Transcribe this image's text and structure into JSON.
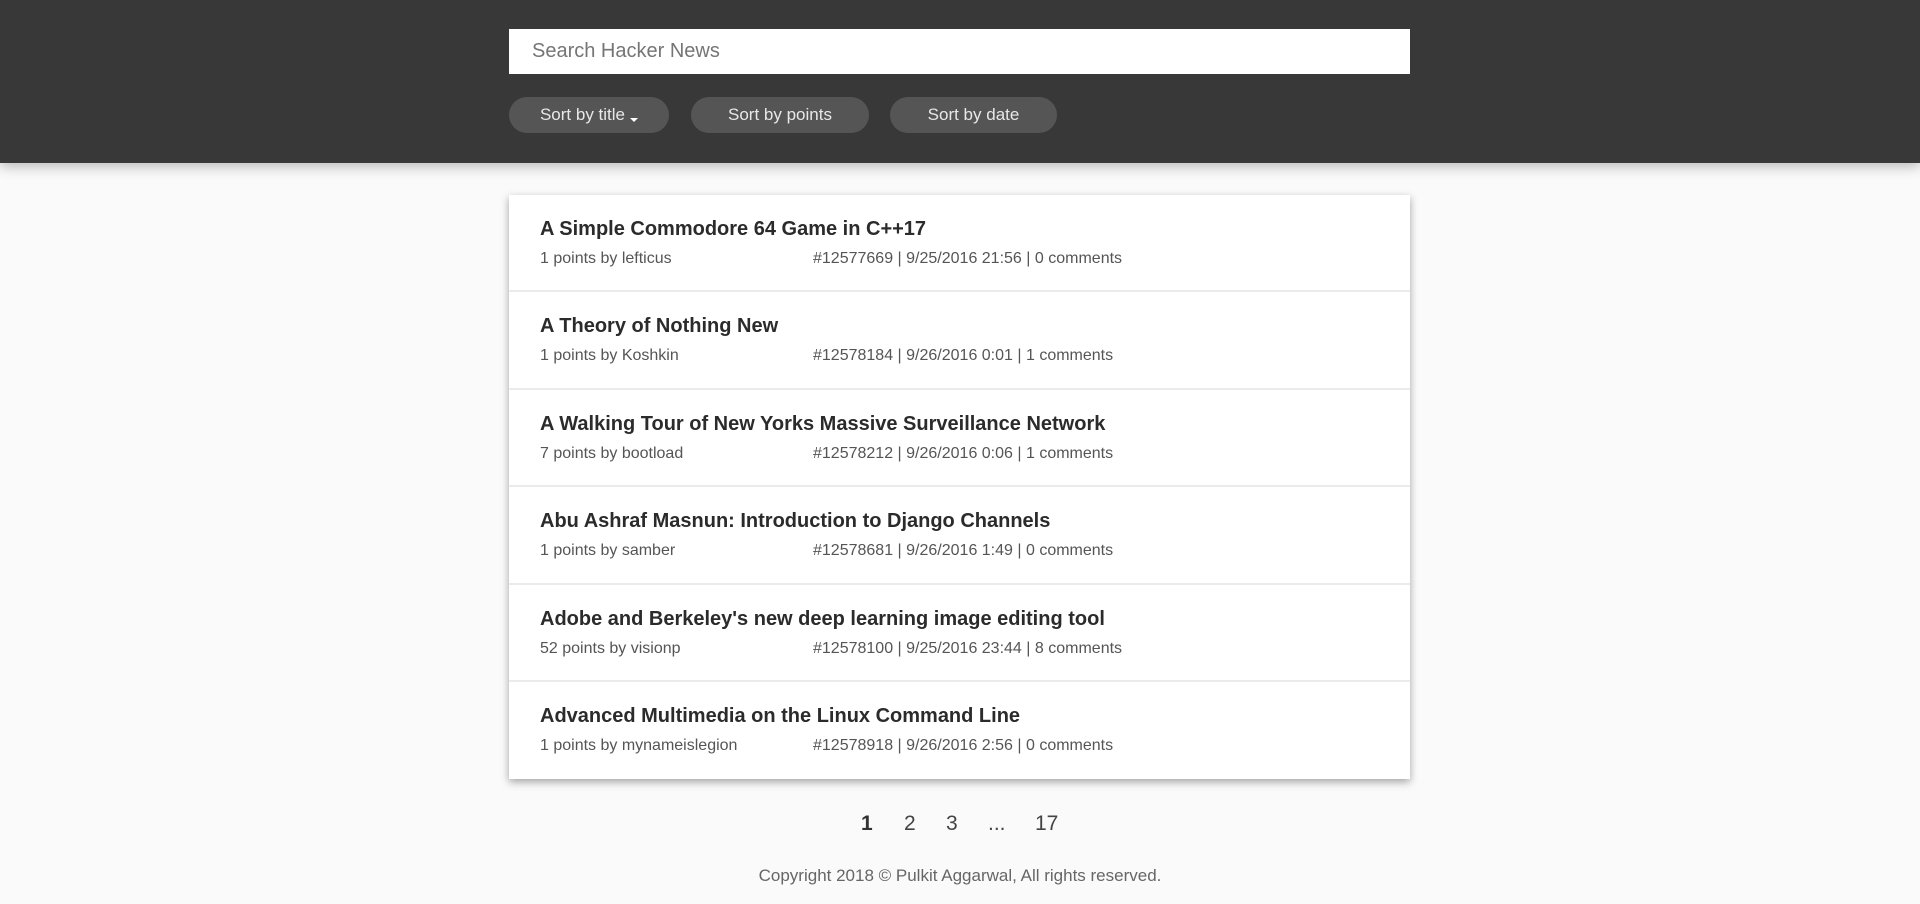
{
  "search": {
    "placeholder": "Search Hacker News",
    "value": ""
  },
  "sort_buttons": [
    {
      "label": "Sort by title",
      "active": true
    },
    {
      "label": "Sort by points"
    },
    {
      "label": "Sort by date"
    }
  ],
  "stories": [
    {
      "title": "A Simple Commodore 64 Game in C++17",
      "byline": "1 points by lefticus",
      "id": "#12577669",
      "date": "9/25/2016 21:56",
      "comments": "0 comments"
    },
    {
      "title": "A Theory of Nothing New",
      "byline": "1 points by Koshkin",
      "id": "#12578184",
      "date": "9/26/2016 0:01",
      "comments": "1 comments"
    },
    {
      "title": "A Walking Tour of New Yorks Massive Surveillance Network",
      "byline": "7 points by bootload",
      "id": "#12578212",
      "date": "9/26/2016 0:06",
      "comments": "1 comments"
    },
    {
      "title": "Abu Ashraf Masnun: Introduction to Django Channels",
      "byline": "1 points by samber",
      "id": "#12578681",
      "date": "9/26/2016 1:49",
      "comments": "0 comments"
    },
    {
      "title": "Adobe and Berkeley's new deep learning image editing tool",
      "byline": "52 points by visionp",
      "id": "#12578100",
      "date": "9/25/2016 23:44",
      "comments": "8 comments"
    },
    {
      "title": "Advanced Multimedia on the Linux Command Line",
      "byline": "1 points by mynameislegion",
      "id": "#12578918",
      "date": "9/26/2016 2:56",
      "comments": "0 comments"
    }
  ],
  "separator": "|",
  "pagination": [
    "1",
    "2",
    "3",
    "...",
    "17"
  ],
  "footer": "Copyright 2018 © Pulkit Aggarwal, All rights reserved."
}
